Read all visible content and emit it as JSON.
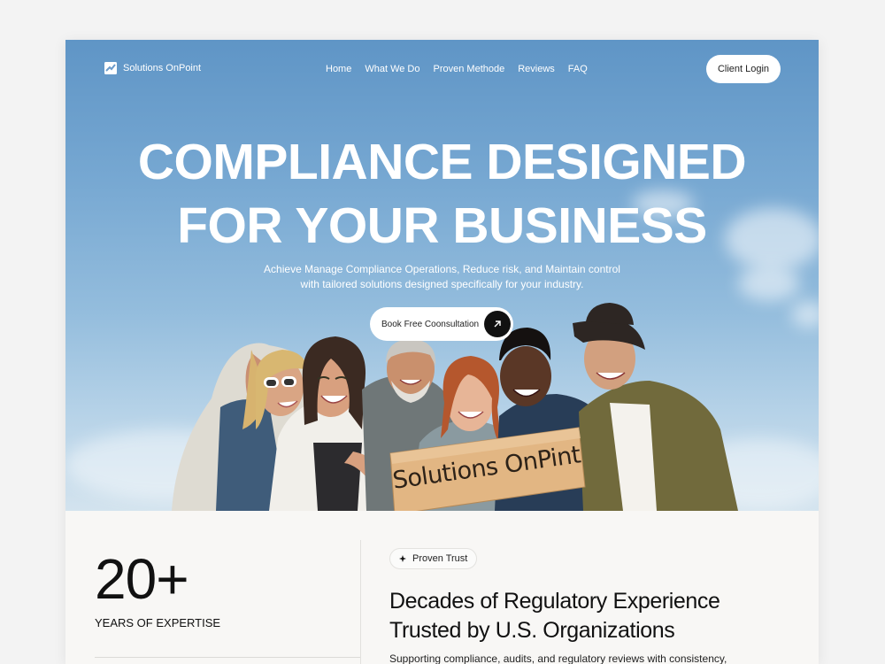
{
  "nav": {
    "brand": "Solutions OnPoint",
    "menu": [
      "Home",
      "What We Do",
      "Proven Methode",
      "Reviews",
      "FAQ"
    ],
    "login": "Client Login"
  },
  "hero": {
    "headline_line1": "COMPLIANCE DESIGNED",
    "headline_line2": "FOR YOUR BUSINESS",
    "subtitle_line1": "Achieve Manage Compliance Operations, Reduce risk, and Maintain control",
    "subtitle_line2": "with tailored solutions designed specifically for your industry.",
    "cta": "Book Free Coonsultation",
    "sign_text": "Solutions OnPint"
  },
  "stats": {
    "number": "20+",
    "label": "YEARS OF EXPERTISE",
    "badge": "Proven Trust",
    "title_line1": "Decades of Regulatory Experience",
    "title_line2": "Trusted by U.S. Organizations",
    "subtitle": "Supporting compliance, audits, and regulatory reviews with consistency,"
  },
  "icons": {
    "brand": "logo-icon",
    "cta": "arrow-up-right-icon",
    "badge": "sparkle-icon"
  },
  "colors": {
    "sky_top": "#5f95c6",
    "sky_bottom": "#d3e3ee",
    "cta_circle": "#111111",
    "card_bg": "#f8f7f5"
  }
}
